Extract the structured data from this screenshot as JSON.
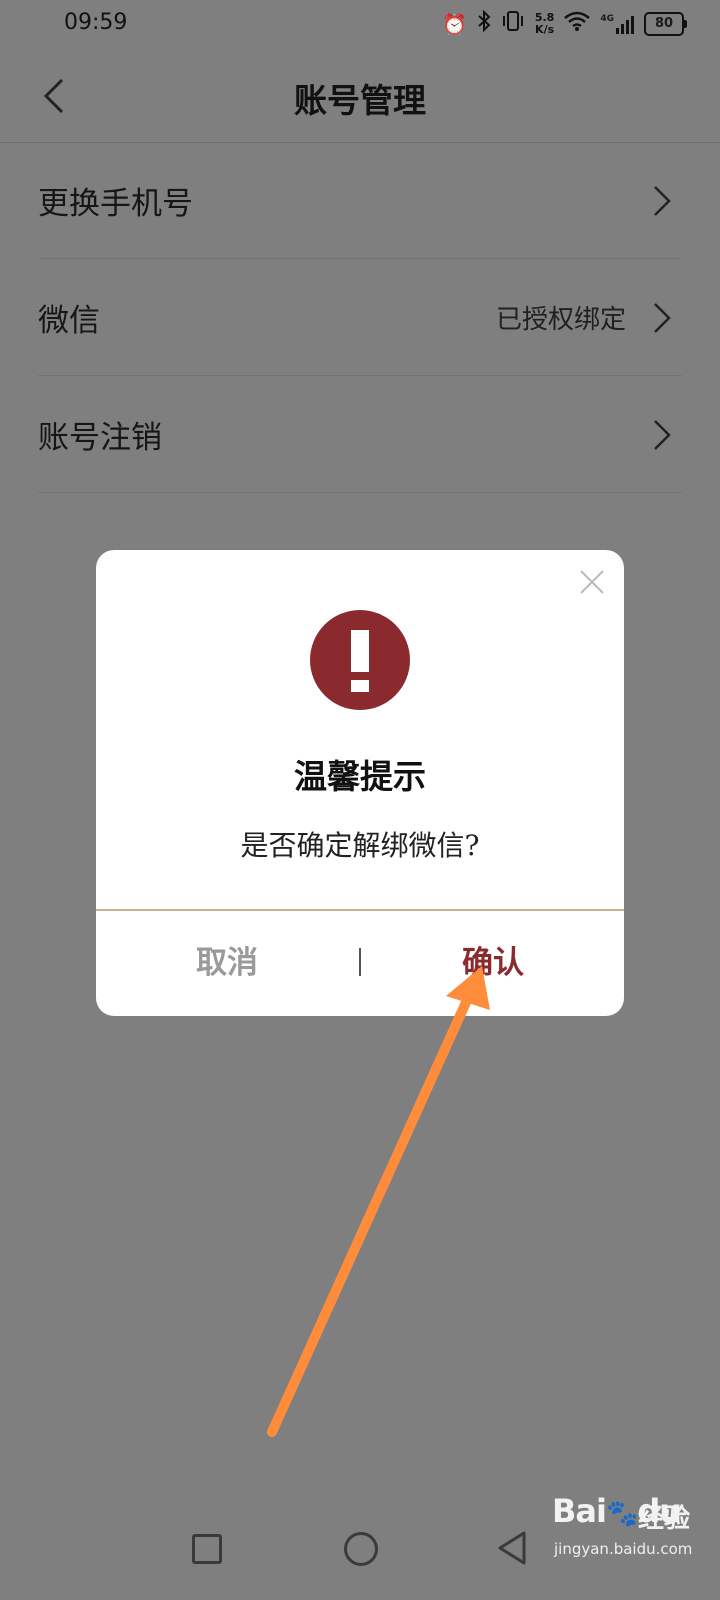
{
  "status_bar": {
    "time": "09:59",
    "net_speed_top": "5.8",
    "net_speed_bottom": "K/s",
    "network_type": "4G",
    "battery": "80",
    "icons": [
      "alarm-icon",
      "bluetooth-icon",
      "vibrate-icon",
      "wifi-icon",
      "signal-icon",
      "battery-icon"
    ]
  },
  "header": {
    "title": "账号管理",
    "back_icon": "chevron-left-icon"
  },
  "list": {
    "items": [
      {
        "label": "更换手机号",
        "value": ""
      },
      {
        "label": "微信",
        "value": "已授权绑定"
      },
      {
        "label": "账号注销",
        "value": ""
      }
    ]
  },
  "dialog": {
    "title": "温馨提示",
    "message": "是否确定解绑微信?",
    "cancel_label": "取消",
    "confirm_label": "确认",
    "icon": "exclamation-icon",
    "accent_color": "#8b2a2e"
  },
  "annotation": {
    "arrow_color": "#ff8c3a"
  },
  "navbar": {
    "icons": [
      "recent-apps-icon",
      "home-icon",
      "back-icon"
    ]
  },
  "watermark": {
    "logo": "Bai",
    "logo_suffix": "du",
    "product": "经验",
    "url": "jingyan.baidu.com"
  }
}
